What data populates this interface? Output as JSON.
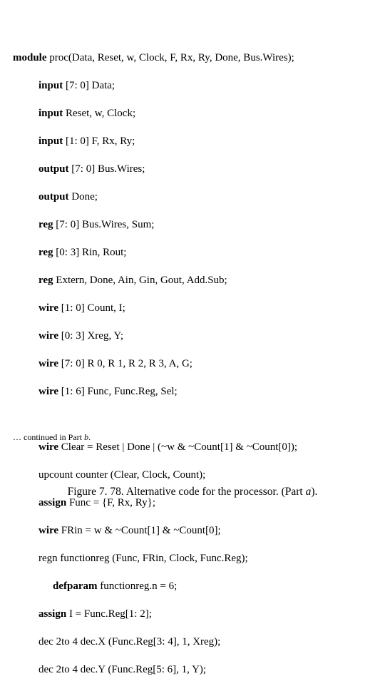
{
  "code": {
    "l1a": "module",
    "l1b": " proc(Data, Reset, w, Clock, F, Rx, Ry, Done, Bus.Wires);",
    "l2a": "input",
    "l2b": " [7: 0] Data;",
    "l3a": "input",
    "l3b": " Reset, w, Clock;",
    "l4a": "input",
    "l4b": " [1: 0] F, Rx, Ry;",
    "l5a": "output",
    "l5b": " [7: 0] Bus.Wires;",
    "l6a": "output",
    "l6b": " Done;",
    "l7a": "reg",
    "l7b": " [7: 0] Bus.Wires, Sum;",
    "l8a": "reg",
    "l8b": " [0: 3] Rin, Rout;",
    "l9a": "reg",
    "l9b": " Extern, Done, Ain, Gin, Gout, Add.Sub;",
    "l10a": "wire",
    "l10b": " [1: 0] Count, I;",
    "l11a": "wire",
    "l11b": " [0: 3] Xreg, Y;",
    "l12a": "wire",
    "l12b": " [7: 0] R 0, R 1, R 2, R 3, A, G;",
    "l13a": "wire",
    "l13b": " [1: 6] Func, Func.Reg, Sel;",
    "l14a": "wire",
    "l14b": " Clear = Reset | Done | (~w & ~Count[1] & ~Count[0]);",
    "l15": "upcount counter (Clear, Clock, Count);",
    "l16a": "assign",
    "l16b": " Func = {F, Rx, Ry};",
    "l17a": "wire",
    "l17b": " FRin = w & ~Count[1] & ~Count[0];",
    "l18": "regn functionreg (Func, FRin, Clock, Func.Reg);",
    "l19a": "defparam",
    "l19b": " functionreg.n = 6;",
    "l20a": "assign",
    "l20b": " I = Func.Reg[1: 2];",
    "l21": "dec 2to 4 dec.X (Func.Reg[3: 4], 1, Xreg);",
    "l22": "dec 2to 4 dec.Y (Func.Reg[5: 6], 1, Y);"
  },
  "continued": "… continued in Part ",
  "continued_i": "b",
  "continued_end": ".",
  "caption_a": "Figure 7. 78.   Alternative code for the processor. (Part ",
  "caption_i": "a",
  "caption_b": ")."
}
